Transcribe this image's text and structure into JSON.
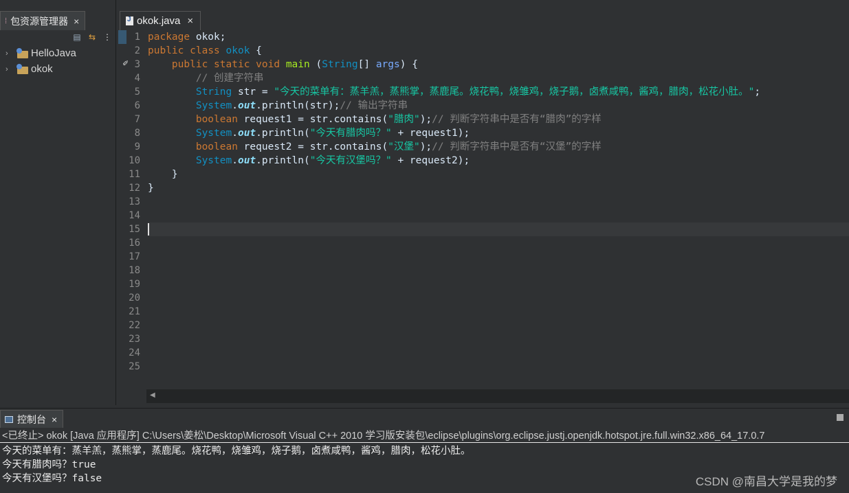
{
  "package_explorer": {
    "tab_label": "包资源管理器",
    "close_glyph": "×",
    "projects": [
      {
        "name": "HelloJava"
      },
      {
        "name": "okok"
      }
    ]
  },
  "editor": {
    "tab_label": "okok.java",
    "close_glyph": "×",
    "line_numbers": [
      "1",
      "2",
      "3",
      "4",
      "5",
      "6",
      "7",
      "8",
      "9",
      "10",
      "11",
      "12",
      "13",
      "14",
      "15",
      "16",
      "17",
      "18",
      "19",
      "20",
      "21",
      "22",
      "23",
      "24",
      "25"
    ],
    "code": {
      "l1_kw": "package",
      "l1_rest": " okok;",
      "l2_kw1": "public",
      "l2_kw2": "class",
      "l2_cls": "okok",
      "l2_rest": " {",
      "l3_kw1": "public",
      "l3_kw2": "static",
      "l3_kw3": "void",
      "l3_mth": "main",
      "l3_p1": " (",
      "l3_cls": "String",
      "l3_p2": "[] ",
      "l3_arg": "args",
      "l3_rest": ") {",
      "l4_cmt": "// 创建字符串",
      "l5_cls": "String",
      "l5_var": " str = ",
      "l5_str": "\"今天的菜单有：蒸羊羔，蒸熊掌，蒸鹿尾。烧花鸭，烧雏鸡，烧子鹅，卤煮咸鸭，酱鸡，腊肉，松花小肚。\"",
      "l5_rest": ";",
      "l6_cls": "System",
      "l6_fld": "out",
      "l6_rest": ".println(str);",
      "l6_cmt": "// 输出字符串",
      "l7_kw": "boolean",
      "l7_mid": " request1 = str.",
      "l7_mth": "contains",
      "l7_p": "(",
      "l7_str": "\"腊肉\"",
      "l7_rest": ");",
      "l7_cmt": "// 判断字符串中是否有“腊肉”的字样",
      "l8_cls": "System",
      "l8_fld": "out",
      "l8_mid": ".println(",
      "l8_str": "\"今天有腊肉吗？\"",
      "l8_rest": " + request1);",
      "l9_kw": "boolean",
      "l9_mid": " request2 = str.",
      "l9_mth": "contains",
      "l9_p": "(",
      "l9_str": "\"汉堡\"",
      "l9_rest": ");",
      "l9_cmt": "// 判断字符串中是否有“汉堡”的字样",
      "l10_cls": "System",
      "l10_fld": "out",
      "l10_mid": ".println(",
      "l10_str": "\"今天有汉堡吗？\"",
      "l10_rest": " + request2);",
      "l11": "}",
      "l12": "}"
    }
  },
  "console": {
    "tab_label": "控制台",
    "close_glyph": "×",
    "status_line": "<已终止> okok [Java 应用程序] C:\\Users\\姜松\\Desktop\\Microsoft Visual C++ 2010 学习版安装包\\eclipse\\plugins\\org.eclipse.justj.openjdk.hotspot.jre.full.win32.x86_64_17.0.7",
    "output": [
      "今天的菜单有：蒸羊羔，蒸熊掌，蒸鹿尾。烧花鸭，烧雏鸡，烧子鹅，卤煮咸鸭，酱鸡，腊肉，松花小肚。",
      "今天有腊肉吗？true",
      "今天有汉堡吗？false"
    ]
  },
  "watermark": "CSDN @南昌大学是我的梦",
  "colors": {
    "background": "#2f3133",
    "keyword": "#cc7832",
    "class": "#1290c3",
    "method": "#a7ec21",
    "string": "#17c6a3",
    "comment": "#808080"
  },
  "icons": [
    "package-explorer-icon",
    "collapse-all-icon",
    "link-editor-icon",
    "view-menu-icon",
    "java-project-icon",
    "java-file-icon",
    "console-icon",
    "maximize-icon",
    "override-marker-icon"
  ]
}
